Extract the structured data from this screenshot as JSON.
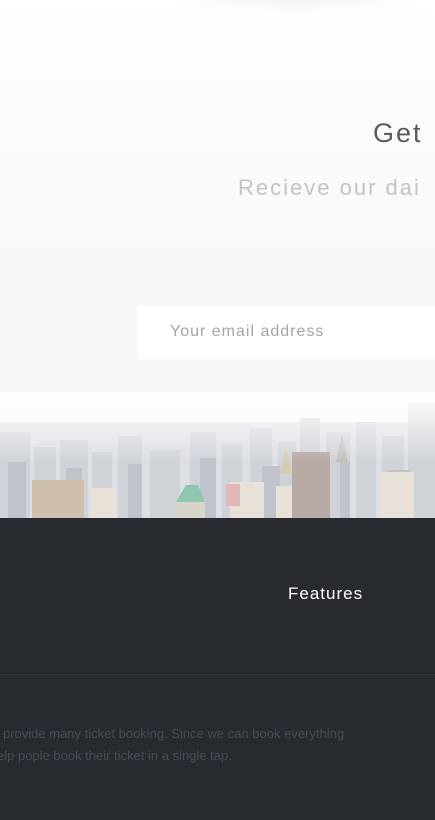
{
  "hero": {
    "title": "Get",
    "subtitle": "Recieve our dai"
  },
  "subscribe": {
    "email_placeholder": "Your email address"
  },
  "footer": {
    "features_link": "Features",
    "description_line1": "provide many ticket booking. Since we can book everything",
    "description_line2": "elp pople book their ticket in a single tap."
  },
  "colors": {
    "dark_background": "#272a2f",
    "title_text": "#5b5b5b",
    "subtitle_text": "#c4c4c4"
  }
}
